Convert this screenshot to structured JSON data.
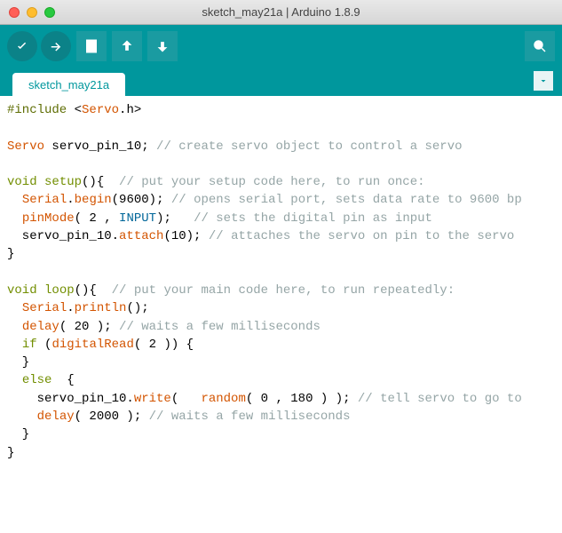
{
  "window": {
    "title": "sketch_may21a | Arduino 1.8.9"
  },
  "tab": {
    "name": "sketch_may21a"
  },
  "code": {
    "l1_a": "#include",
    "l1_b": " <",
    "l1_c": "Servo",
    "l1_d": ".h>",
    "l3_a": "Servo",
    "l3_b": " servo_pin_10; ",
    "l3_c": "// create servo object to control a servo",
    "l5_a": "void",
    "l5_b": " ",
    "l5_c": "setup",
    "l5_d": "(){  ",
    "l5_e": "// put your setup code here, to run once:",
    "l6_a": "  ",
    "l6_b": "Serial",
    "l6_c": ".",
    "l6_d": "begin",
    "l6_e": "(9600); ",
    "l6_f": "// opens serial port, sets data rate to 9600 bp",
    "l7_a": "  ",
    "l7_b": "pinMode",
    "l7_c": "( 2 , ",
    "l7_d": "INPUT",
    "l7_e": ");   ",
    "l7_f": "// sets the digital pin as input",
    "l8_a": "  servo_pin_10.",
    "l8_b": "attach",
    "l8_c": "(10); ",
    "l8_d": "// attaches the servo on pin to the servo ",
    "l9_a": "}",
    "l11_a": "void",
    "l11_b": " ",
    "l11_c": "loop",
    "l11_d": "(){  ",
    "l11_e": "// put your main code here, to run repeatedly:",
    "l12_a": "  ",
    "l12_b": "Serial",
    "l12_c": ".",
    "l12_d": "println",
    "l12_e": "();",
    "l13_a": "  ",
    "l13_b": "delay",
    "l13_c": "( 20 ); ",
    "l13_d": "// waits a few milliseconds",
    "l14_a": "  ",
    "l14_b": "if",
    "l14_c": " (",
    "l14_d": "digitalRead",
    "l14_e": "( 2 )) {",
    "l15_a": "  }",
    "l16_a": "  ",
    "l16_b": "else",
    "l16_c": "  {",
    "l17_a": "    servo_pin_10.",
    "l17_b": "write",
    "l17_c": "(   ",
    "l17_d": "random",
    "l17_e": "( 0 , 180 ) ); ",
    "l17_f": "// tell servo to go to",
    "l18_a": "    ",
    "l18_b": "delay",
    "l18_c": "( 2000 ); ",
    "l18_d": "// waits a few milliseconds",
    "l19_a": "  }",
    "l20_a": "}"
  }
}
